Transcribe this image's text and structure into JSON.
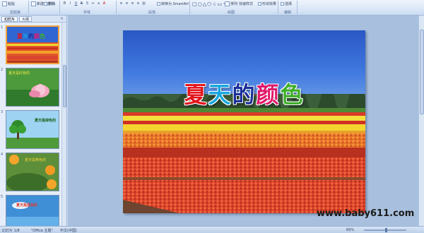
{
  "ribbon": {
    "clipboard_label": "剪贴板",
    "paste_label": "粘贴",
    "new_slide_label": "新建\n幻灯片",
    "delete_label": "删除",
    "font_group_label": "字体",
    "paragraph_group_label": "段落",
    "smartart_label": "转换为 SmartArt",
    "drawing_group_label": "绘图",
    "arrange_label": "排列",
    "quick_styles_label": "快速样式",
    "shape_effects_label": "形状效果",
    "select_label": "选择",
    "editing_group_label": "编辑"
  },
  "left_pane": {
    "tabs": [
      "幻灯片",
      "大纲"
    ],
    "close_glyph": "×",
    "thumbnails": [
      {
        "num": "1",
        "caption": "夏天的颜色"
      },
      {
        "num": "2",
        "caption": "夏天是红色的"
      },
      {
        "num": "3",
        "caption": "夏天是绿色的"
      },
      {
        "num": "4",
        "caption": "夏天是黄色的"
      },
      {
        "num": "5",
        "caption": "夏天是蓝色的"
      }
    ]
  },
  "slide": {
    "title_chars": [
      "夏",
      "天",
      "的",
      "颜",
      "色"
    ],
    "title_colors": [
      "#e3141c",
      "#19a7e0",
      "#1b2f9a",
      "#e0176a",
      "#3fae2a"
    ]
  },
  "watermark": "www.baby611.com",
  "status": {
    "slide_counter": "幻灯片 1/8",
    "theme": "\"Office 主题\"",
    "language": "中文(中国)",
    "zoom": "69%"
  },
  "colors": {
    "ribbon_bg": "#dbe7f7",
    "pane_bg": "#e4edf9",
    "edit_bg": "#a8c0dd",
    "selected_border": "#f2a23c"
  }
}
